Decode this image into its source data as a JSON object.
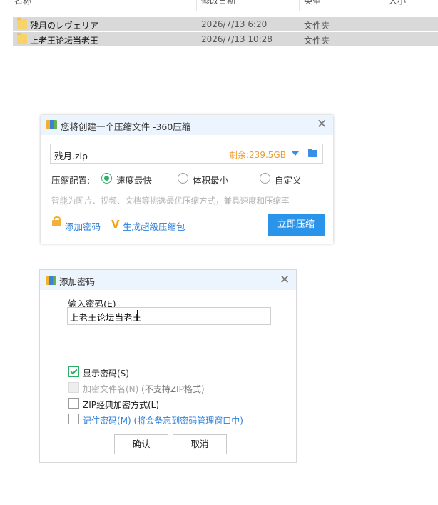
{
  "explorer": {
    "columns": [
      "名称",
      "修改日期",
      "类型",
      "大小"
    ],
    "rows": [
      {
        "name": "残月のレヴェリア",
        "date": "2026/7/13 6:20",
        "type": "文件夹"
      },
      {
        "name": "上老王论坛当老王",
        "date": "2026/7/13 10:28",
        "type": "文件夹"
      }
    ]
  },
  "compress_dialog": {
    "title": "您将创建一个压缩文件 -360压缩",
    "close_icon": "close-icon",
    "filename": "残月.zip",
    "free_space": "剩余:239.5GB",
    "config_label": "压缩配置:",
    "options": [
      "速度最快",
      "体积最小",
      "自定义"
    ],
    "selected_option": "速度最快",
    "hint": "智能为图片、视频、文档等挑选最优压缩方式，兼具速度和压缩率",
    "add_password": "添加密码",
    "super_pack": "生成超级压缩包",
    "compress_now": "立即压缩",
    "colors": {
      "accent": "#2a93ea",
      "free_space": "#f09b2b",
      "radio_on": "#2fae6a"
    }
  },
  "password_dialog": {
    "title": "添加密码",
    "input_label": "输入密码(E)",
    "password_value": "上老王论坛当老王",
    "options": [
      {
        "label": "显示密码(S)",
        "note": "",
        "checked": true,
        "enabled": true
      },
      {
        "label": "加密文件名(N)",
        "note": "(不支持ZIP格式)",
        "checked": false,
        "enabled": false
      },
      {
        "label": "ZIP经典加密方式(L)",
        "note": "",
        "checked": false,
        "enabled": true
      },
      {
        "label": "记住密码(M)",
        "note": "(将会备忘到密码管理窗口中)",
        "checked": false,
        "enabled": true
      }
    ],
    "ok": "确认",
    "cancel": "取消"
  }
}
